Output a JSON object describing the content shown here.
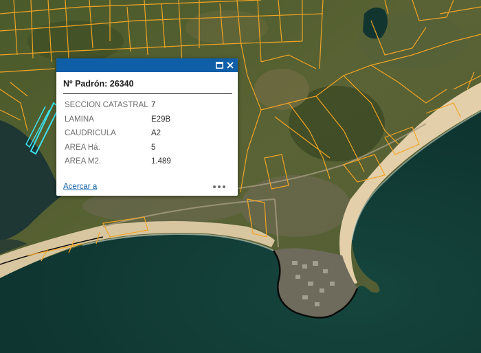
{
  "map": {
    "parcel_outline_color": "#f2a425",
    "highlight_color": "#3de0f0",
    "sea_color": "#15463d",
    "beach_color": "#e3cfa9"
  },
  "popup": {
    "header_color": "#0e5fa8",
    "title": "Nº Padrón: 26340",
    "dock_icon": "dock-icon",
    "close_icon": "close-icon",
    "attributes": [
      {
        "name": "SECCION CATASTRAL",
        "value": "7"
      },
      {
        "name": "LAMINA",
        "value": "E29B"
      },
      {
        "name": "CAUDRICULA",
        "value": "A2"
      },
      {
        "name": "AREA Há.",
        "value": "5"
      },
      {
        "name": "AREA M2.",
        "value": "1.489"
      }
    ],
    "zoom_link": "Acercar a",
    "more_icon": "more-options-icon"
  }
}
